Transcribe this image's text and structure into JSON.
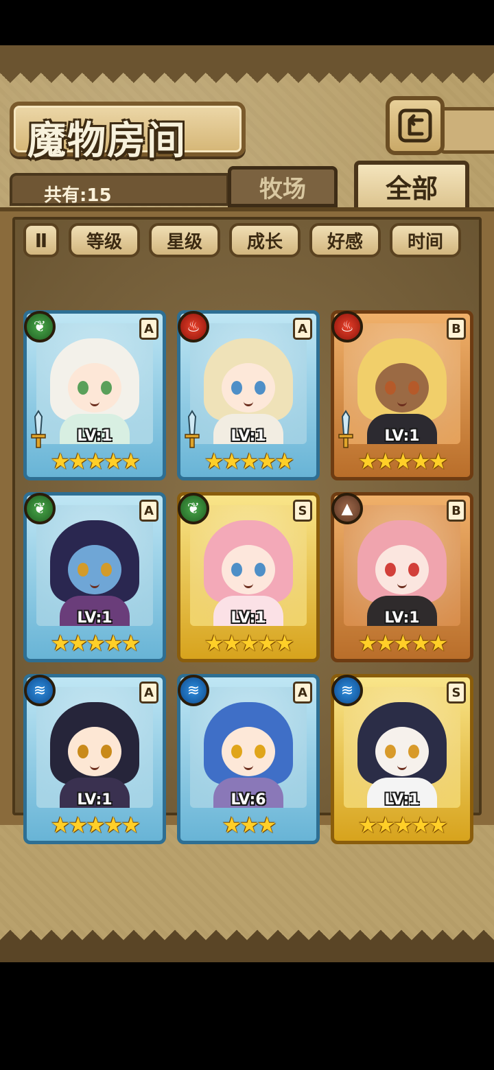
{
  "header": {
    "title": "魔物房间"
  },
  "summary": {
    "count_label": "共有:15"
  },
  "tabs": [
    {
      "label": "牧场",
      "active": false
    },
    {
      "label": "全部",
      "active": true
    }
  ],
  "sort": {
    "toggle_glyph": "Ⅱ",
    "buttons": [
      "等级",
      "星级",
      "成长",
      "好感",
      "时间"
    ]
  },
  "cards": [
    {
      "element": "grass",
      "element_icon": "leaf-icon",
      "rank": "A",
      "level": "LV:1",
      "stars": "★★★★★",
      "frame": "blue",
      "equip": true
    },
    {
      "element": "fire",
      "element_icon": "flame-icon",
      "rank": "A",
      "level": "LV:1",
      "stars": "★★★★★",
      "frame": "blue",
      "equip": true
    },
    {
      "element": "fire",
      "element_icon": "flame-icon",
      "rank": "B",
      "level": "LV:1",
      "stars": "★★★★★",
      "frame": "bronze",
      "equip": true
    },
    {
      "element": "grass",
      "element_icon": "leaf-icon",
      "rank": "A",
      "level": "LV:1",
      "stars": "★★★★★",
      "frame": "blue",
      "equip": false
    },
    {
      "element": "grass",
      "element_icon": "leaf-icon",
      "rank": "S",
      "level": "LV:1",
      "stars": "★★★★★",
      "frame": "gold",
      "equip": false
    },
    {
      "element": "earth",
      "element_icon": "mountain-icon",
      "rank": "B",
      "level": "LV:1",
      "stars": "★★★★★",
      "frame": "bronze",
      "equip": false
    },
    {
      "element": "water",
      "element_icon": "water-icon",
      "rank": "A",
      "level": "LV:1",
      "stars": "★★★★★",
      "frame": "blue",
      "equip": false
    },
    {
      "element": "water",
      "element_icon": "water-icon",
      "rank": "A",
      "level": "LV:6",
      "stars": "★★★",
      "frame": "blue",
      "equip": false
    },
    {
      "element": "water",
      "element_icon": "water-icon",
      "rank": "S",
      "level": "LV:1",
      "stars": "★★★★★",
      "frame": "gold",
      "equip": false
    }
  ]
}
